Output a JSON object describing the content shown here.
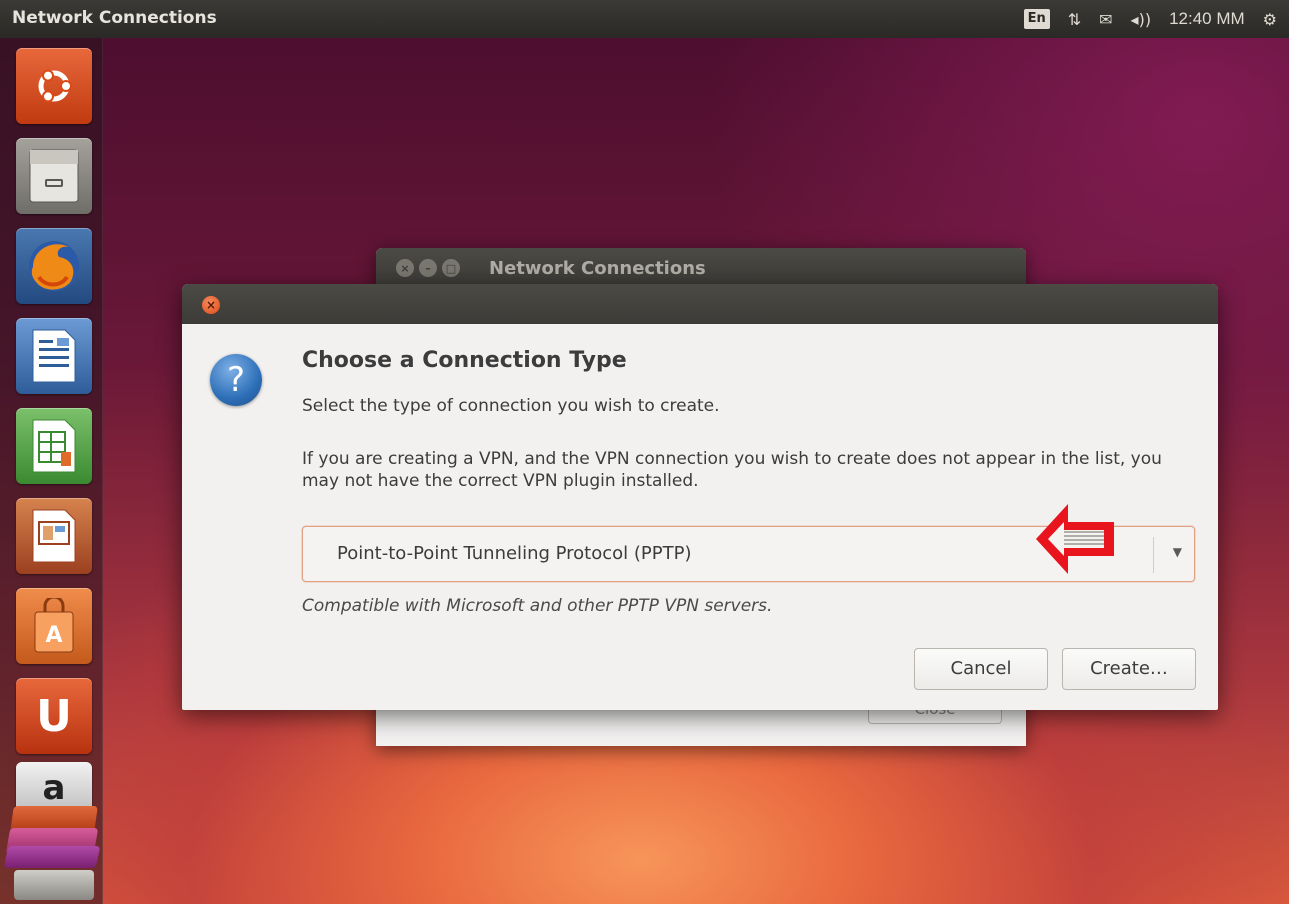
{
  "top_panel": {
    "app_title": "Network Connections",
    "keyboard_layout": "En",
    "network_glyph": "⇅",
    "mail_glyph": "✉",
    "sound_glyph": "◂))",
    "clock": "12:40 MM",
    "settings_glyph": "⚙"
  },
  "launcher": {
    "items": [
      {
        "name": "ubuntu-dash",
        "icon": "ubuntu-logo-icon",
        "color": "#dd4814"
      },
      {
        "name": "files",
        "icon": "file-cabinet-icon",
        "color": "#8c8a86"
      },
      {
        "name": "firefox",
        "icon": "firefox-icon",
        "color": "#e66000"
      },
      {
        "name": "libreoffice-writer",
        "icon": "document-icon",
        "color": "#3a6aa8"
      },
      {
        "name": "libreoffice-calc",
        "icon": "spreadsheet-icon",
        "color": "#3c9a3c"
      },
      {
        "name": "libreoffice-impress",
        "icon": "presentation-icon",
        "color": "#b8542c"
      },
      {
        "name": "software-center",
        "icon": "shopping-bag-icon",
        "color": "#e0702c"
      },
      {
        "name": "ubuntu-one",
        "icon": "ubuntu-one-icon",
        "color": "#dd4814"
      },
      {
        "name": "amazon",
        "icon": "amazon-icon",
        "color": "#dddddd"
      }
    ],
    "amazon_letter": "a",
    "ubuntu_one_letter": "U"
  },
  "back_window": {
    "title": "Network Connections",
    "close_label": "Close"
  },
  "dialog": {
    "close_glyph": "×",
    "question_glyph": "?",
    "heading": "Choose a Connection Type",
    "subheading": "Select the type of connection you wish to create.",
    "info": "If you are creating a VPN, and the VPN connection you wish to create does not appear in the list, you may not have the correct VPN plugin installed.",
    "connection_type": "Point-to-Point Tunneling Protocol (PPTP)",
    "dropdown_glyph": "▼",
    "description": "Compatible with Microsoft and other PPTP VPN servers.",
    "cancel_label": "Cancel",
    "create_label": "Create…"
  },
  "colors": {
    "accent": "#dd4814",
    "annotation_arrow": "#e8141e"
  }
}
